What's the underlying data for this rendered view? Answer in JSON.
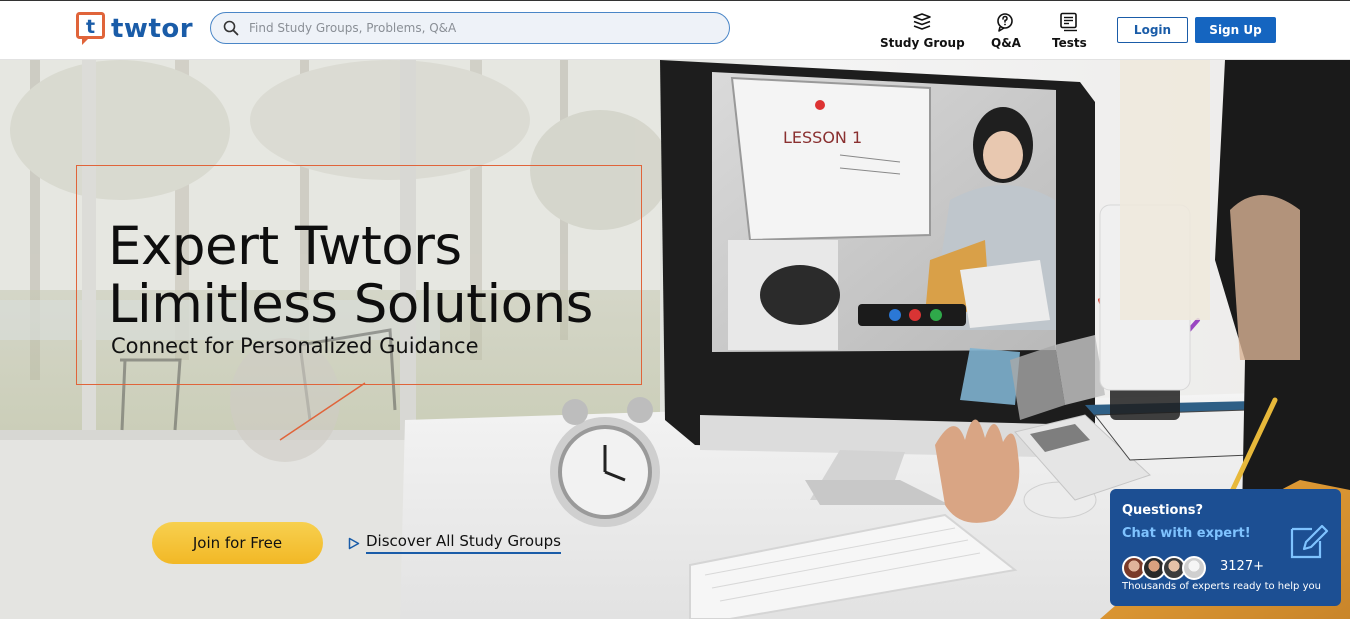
{
  "brand": {
    "name": "twtor",
    "mark_letter": "t",
    "primary_color": "#1a5ca8",
    "accent_color": "#e0643a"
  },
  "search": {
    "placeholder": "Find Study Groups, Problems, Q&A",
    "value": "",
    "icon": "search-icon"
  },
  "nav": {
    "items": [
      {
        "label": "Study Group",
        "icon": "stack-icon"
      },
      {
        "label": "Q&A",
        "icon": "chat-question-icon"
      },
      {
        "label": "Tests",
        "icon": "test-sheet-icon"
      }
    ]
  },
  "auth": {
    "login_label": "Login",
    "signup_label": "Sign Up"
  },
  "hero": {
    "headline_line1": "Expert Twtors",
    "headline_line2": "Limitless Solutions",
    "subheadline": "Connect for Personalized Guidance",
    "join_label": "Join for Free",
    "discover_label": "Discover All Study Groups",
    "screen_lesson_text": "LESSON 1"
  },
  "chat_widget": {
    "question": "Questions?",
    "cta": "Chat with expert!",
    "count": "3127+",
    "subtext": "Thousands of experts ready to help you",
    "icon": "edit-icon"
  }
}
